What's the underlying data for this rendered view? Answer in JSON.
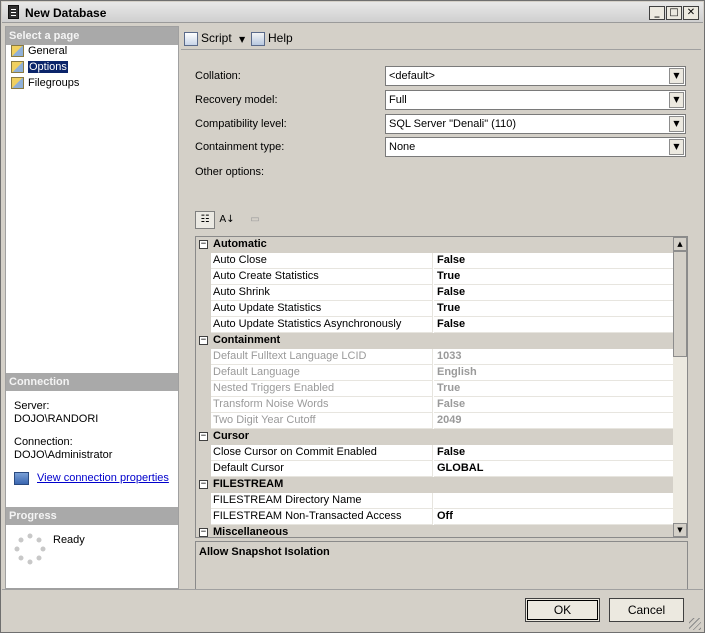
{
  "window": {
    "title": "New Database"
  },
  "sidebar": {
    "select_page_header": "Select a page",
    "pages": [
      {
        "label": "General",
        "icon": "page-icon"
      },
      {
        "label": "Options",
        "icon": "page-icon",
        "selected": true
      },
      {
        "label": "Filegroups",
        "icon": "page-icon"
      }
    ],
    "connection_header": "Connection",
    "server_label": "Server:",
    "server_value": "DOJO\\RANDORI",
    "connection_label": "Connection:",
    "connection_value": "DOJO\\Administrator",
    "view_props_link": "View connection properties",
    "progress_header": "Progress",
    "progress_status": "Ready"
  },
  "toolbar": {
    "script_label": "Script",
    "help_label": "Help"
  },
  "form": {
    "collation_label": "Collation:",
    "collation_value": "<default>",
    "recovery_label": "Recovery model:",
    "recovery_value": "Full",
    "compat_label": "Compatibility level:",
    "compat_value": "SQL Server \"Denali\" (110)",
    "containment_label": "Containment type:",
    "containment_value": "None",
    "other_options_label": "Other options:"
  },
  "grid": {
    "automatic": {
      "name": "Automatic",
      "rows": [
        {
          "name": "Auto Close",
          "value": "False"
        },
        {
          "name": "Auto Create Statistics",
          "value": "True"
        },
        {
          "name": "Auto Shrink",
          "value": "False"
        },
        {
          "name": "Auto Update Statistics",
          "value": "True"
        },
        {
          "name": "Auto Update Statistics Asynchronously",
          "value": "False"
        }
      ]
    },
    "containment": {
      "name": "Containment",
      "rows": [
        {
          "name": "Default Fulltext Language LCID",
          "value": "1033"
        },
        {
          "name": "Default Language",
          "value": "English"
        },
        {
          "name": "Nested Triggers Enabled",
          "value": "True"
        },
        {
          "name": "Transform Noise Words",
          "value": "False"
        },
        {
          "name": "Two Digit Year Cutoff",
          "value": "2049"
        }
      ]
    },
    "cursor": {
      "name": "Cursor",
      "rows": [
        {
          "name": "Close Cursor on Commit Enabled",
          "value": "False"
        },
        {
          "name": "Default Cursor",
          "value": "GLOBAL"
        }
      ]
    },
    "filestream": {
      "name": "FILESTREAM",
      "rows": [
        {
          "name": "FILESTREAM Directory Name",
          "value": ""
        },
        {
          "name": "FILESTREAM Non-Transacted Access",
          "value": "Off"
        }
      ]
    },
    "misc": {
      "name": "Miscellaneous"
    }
  },
  "description": {
    "title": "Allow Snapshot Isolation"
  },
  "buttons": {
    "ok": "OK",
    "cancel": "Cancel"
  },
  "colors": {
    "selection": "#0a246a",
    "section_header": "#a9a9a9",
    "link": "#0000cc"
  }
}
